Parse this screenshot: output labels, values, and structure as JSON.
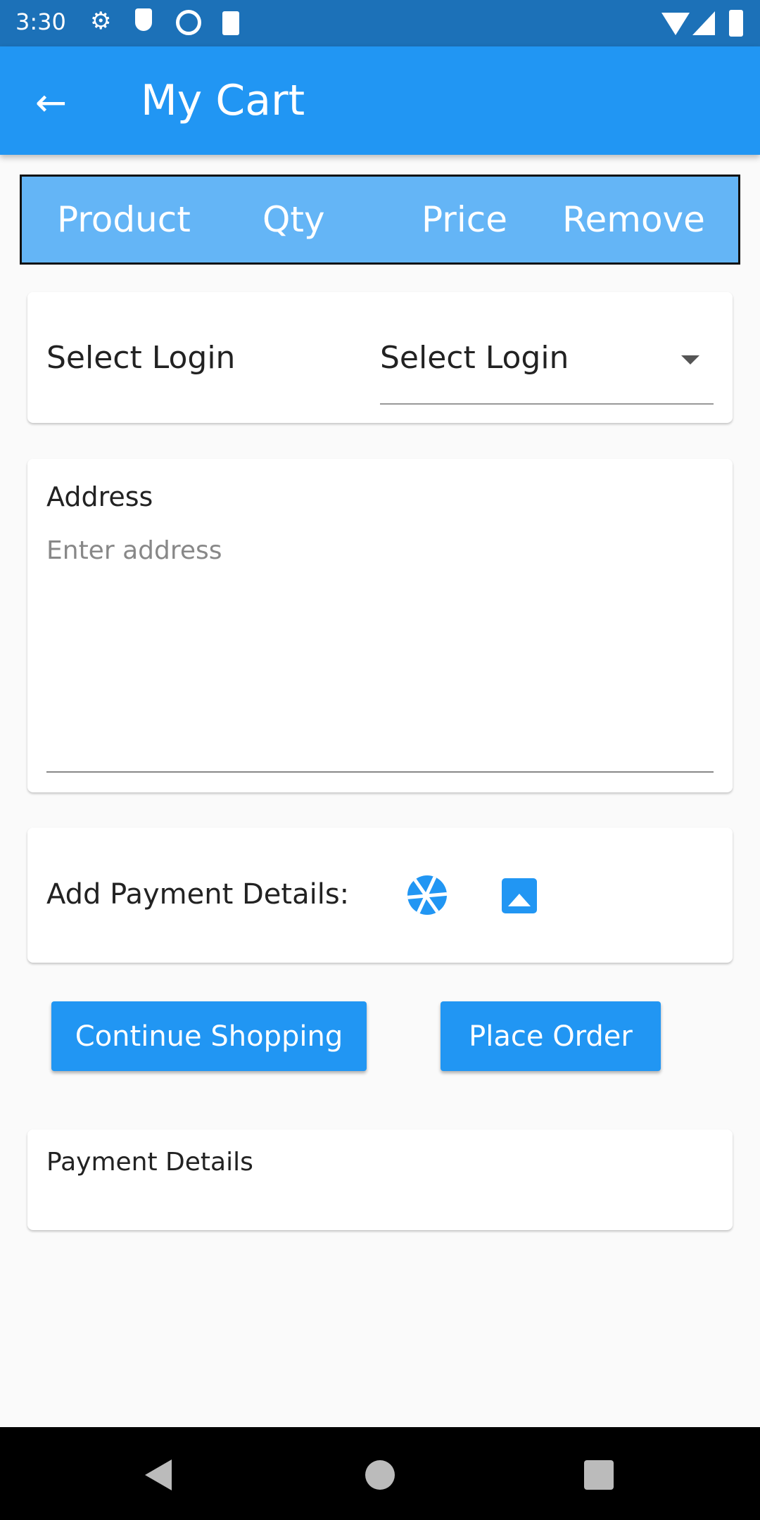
{
  "status_bar": {
    "time": "3:30",
    "icons": [
      "settings-icon",
      "shield-icon",
      "q-icon",
      "sd-card-icon",
      "wifi-icon",
      "signal-icon",
      "battery-icon"
    ]
  },
  "app_bar": {
    "title": "My Cart",
    "back_icon": "arrow-left-icon"
  },
  "table_header": {
    "columns": [
      "Product",
      "Qty",
      "Price",
      "Remove"
    ]
  },
  "login_card": {
    "label": "Select Login",
    "dropdown_value": "Select Login"
  },
  "address_card": {
    "label": "Address",
    "placeholder": "Enter address"
  },
  "payment_card": {
    "label": "Add Payment Details:",
    "icons": [
      "camera-icon",
      "image-icon"
    ]
  },
  "buttons": {
    "continue": "Continue Shopping",
    "place_order": "Place Order"
  },
  "payment_details": {
    "label": "Payment Details"
  },
  "colors": {
    "primary": "#2196f3",
    "status_bar": "#1c71b8",
    "header": "#64b5f6"
  }
}
